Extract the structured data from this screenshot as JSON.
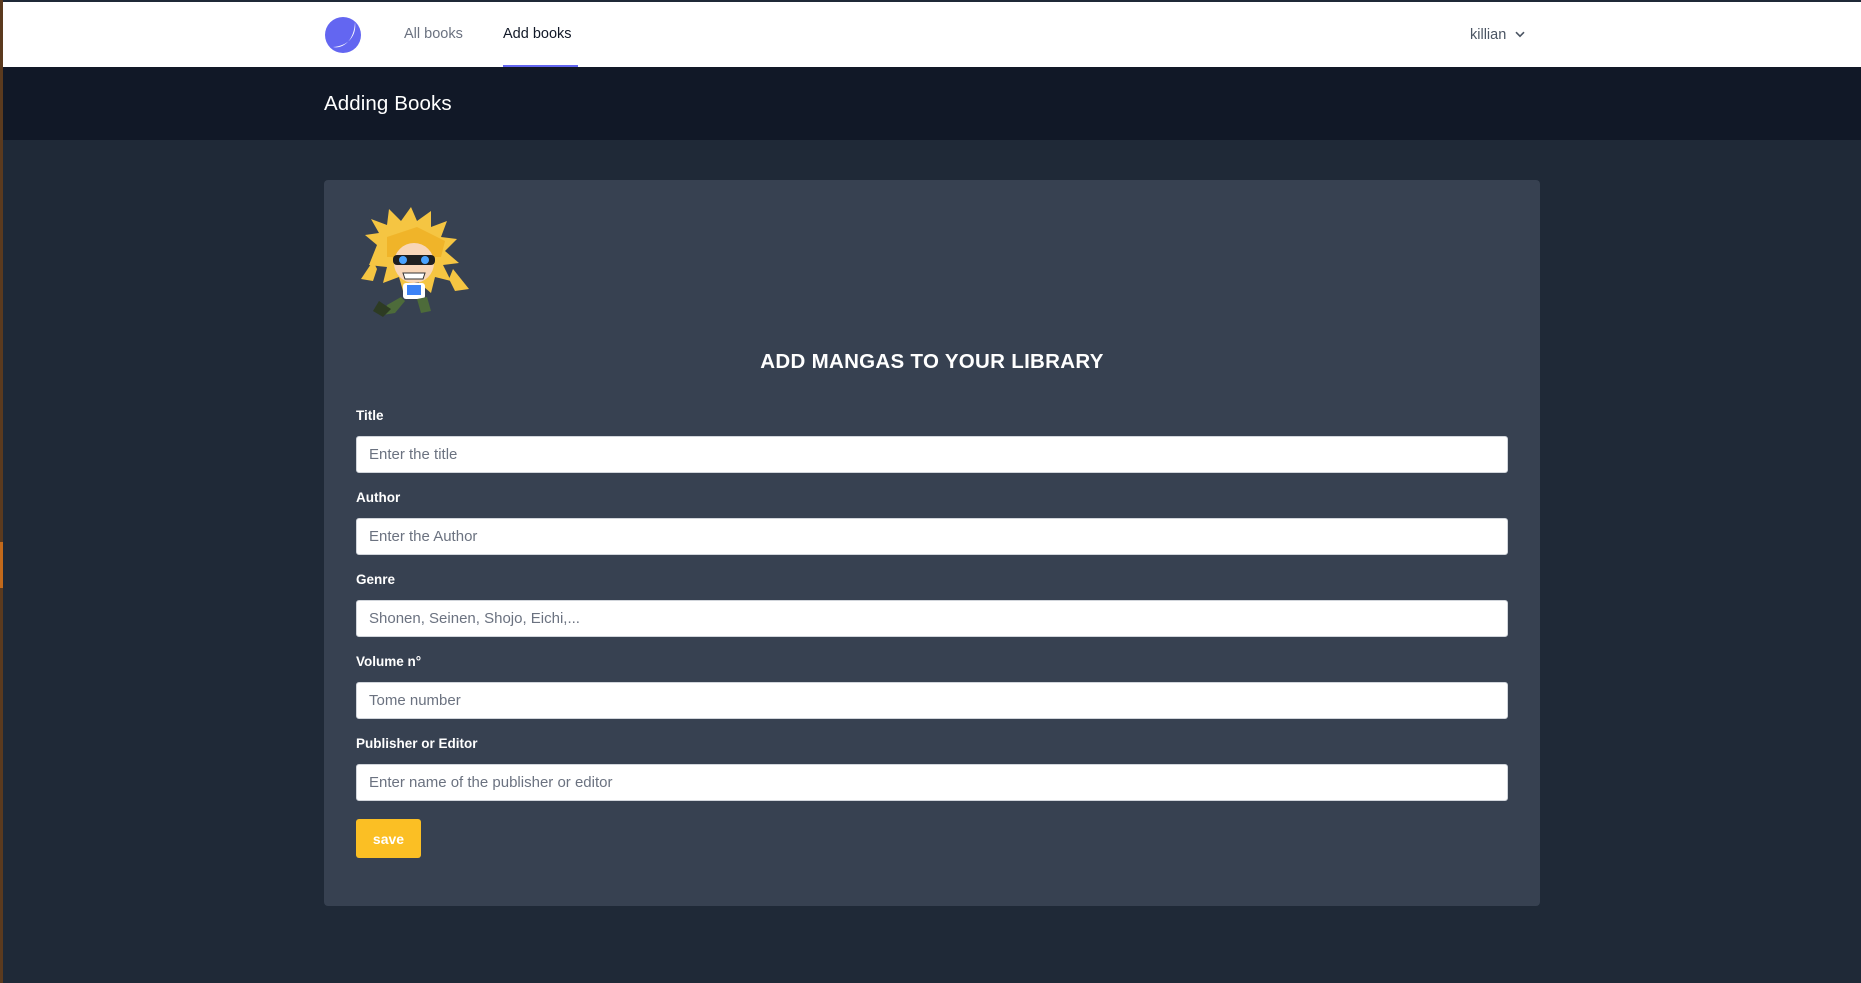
{
  "nav": {
    "logo_icon": "moon-logo-icon",
    "links": [
      {
        "label": "All books"
      },
      {
        "label": "Add books",
        "active": true
      }
    ],
    "user": {
      "name": "killian",
      "icon": "chevron-down-icon"
    }
  },
  "header": {
    "title": "Adding Books"
  },
  "form": {
    "avatar": "chibi-character-avatar",
    "heading": "ADD MANGAS TO YOUR LIBRARY",
    "fields": [
      {
        "label": "Title",
        "placeholder": "Enter the title",
        "value": ""
      },
      {
        "label": "Author",
        "placeholder": "Enter the Author",
        "value": ""
      },
      {
        "label": "Genre",
        "placeholder": "Shonen, Seinen, Shojo, Eichi,...",
        "value": ""
      },
      {
        "label": "Volume n°",
        "placeholder": "Tome number",
        "value": ""
      },
      {
        "label": "Publisher or Editor",
        "placeholder": "Enter name of the publisher or editor",
        "value": ""
      }
    ],
    "save_label": "save"
  },
  "colors": {
    "accent": "#6366f1",
    "save_button": "#fbbf24",
    "header_bg": "#111827",
    "card_bg": "#374151",
    "page_bg": "#1f2937"
  }
}
